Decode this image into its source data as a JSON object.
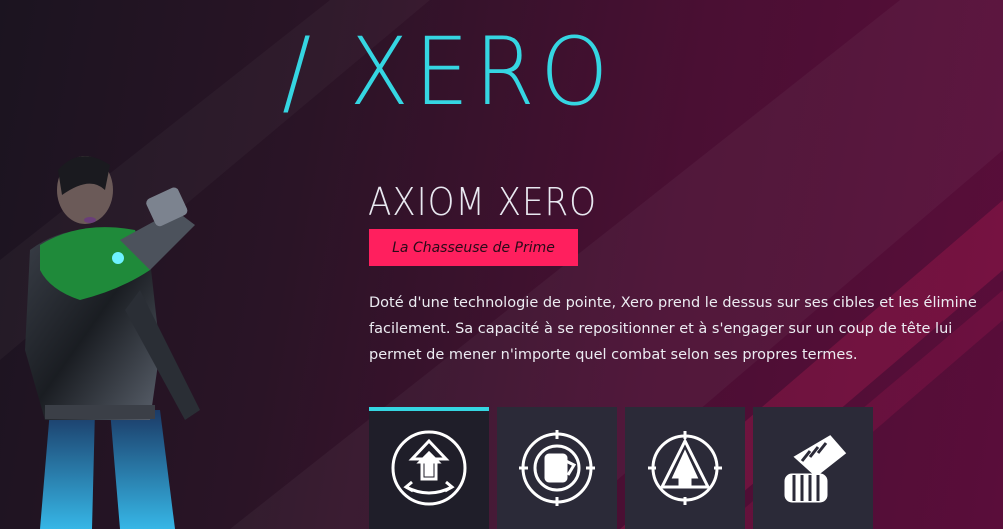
{
  "hero": {
    "title": "/ XERO",
    "name": "AXIOM XERO",
    "role": "La Chasseuse de Prime",
    "description": "Doté d'une technologie de pointe, Xero prend le dessus sur ses cibles et les élimine facilement. Sa capacité à se repositionner et à s'engager sur un coup de tête lui permet de mener n'importe quel combat selon ses propres termes."
  },
  "abilities": [
    {
      "icon": "reposition-arrow-icon",
      "selected": true
    },
    {
      "icon": "target-hand-icon",
      "selected": false
    },
    {
      "icon": "triple-arrow-emblem-icon",
      "selected": false
    },
    {
      "icon": "gauntlet-fist-icon",
      "selected": false
    }
  ],
  "colors": {
    "accent_cyan": "#35d6e2",
    "badge_pink": "#ff1f5e",
    "tile_bg": "#2b2a38",
    "tile_active_bg": "#1f1e29"
  }
}
